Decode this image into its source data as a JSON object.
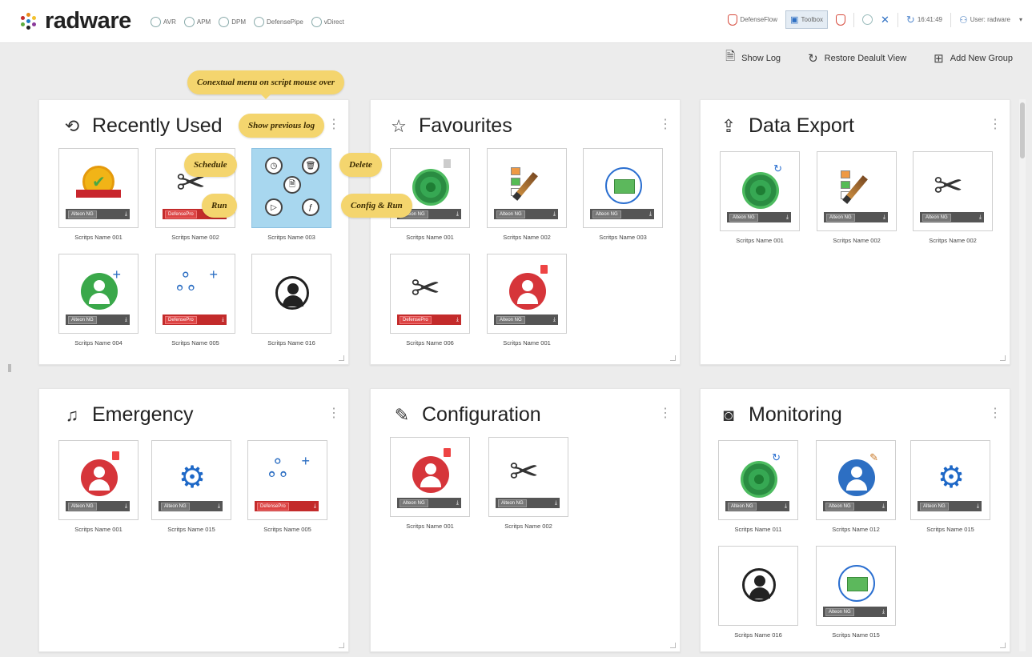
{
  "app": {
    "logo_text": "radware"
  },
  "app_nav": [
    {
      "label": "AVR"
    },
    {
      "label": "APM"
    },
    {
      "label": "DPM"
    },
    {
      "label": "DefensePipe"
    },
    {
      "label": "vDirect"
    }
  ],
  "top_right": {
    "defenseflow": "DefenseFlow",
    "toolbox": "Toolbox",
    "time": "16:41:49",
    "user": "User: radware"
  },
  "actions": {
    "show_log": "Show Log",
    "restore_default": "Restore Dealult View",
    "add_group": "Add New Group"
  },
  "callouts": {
    "contextual": "Conextual menu on script mouse over",
    "show_previous_log": "Show previous log",
    "schedule": "Schedule",
    "delete": "Delete",
    "run": "Run",
    "config_run": "Config & Run"
  },
  "panels": {
    "recent": {
      "title": "Recently Used",
      "scripts": [
        {
          "name": "Scritps Name 001",
          "tag": "Alteon NG"
        },
        {
          "name": "Scritps Name 002",
          "tag": "DefensePro"
        },
        {
          "name": "Scritps Name 003",
          "tag": ""
        },
        {
          "name": "Scritps Name 004",
          "tag": "Alteon NG"
        },
        {
          "name": "Scritps Name 005",
          "tag": "DefensePro"
        },
        {
          "name": "Scritps Name 016",
          "tag": ""
        }
      ]
    },
    "favourites": {
      "title": "Favourites",
      "scripts": [
        {
          "name": "Scritps Name 001",
          "tag": "Alteon NG"
        },
        {
          "name": "Scritps Name 002",
          "tag": "Alteon NG"
        },
        {
          "name": "Scritps Name 003",
          "tag": "Alteon NG"
        },
        {
          "name": "Scritps Name 006",
          "tag": "DefensePro"
        },
        {
          "name": "Scritps Name 001",
          "tag": "Alteon NG"
        }
      ]
    },
    "export": {
      "title": "Data Export",
      "scripts": [
        {
          "name": "Scritps Name 001",
          "tag": "Alteon NG"
        },
        {
          "name": "Scritps Name 002",
          "tag": "Alteon NG"
        },
        {
          "name": "Scritps Name 002",
          "tag": "Alteon NG"
        }
      ]
    },
    "emergency": {
      "title": "Emergency",
      "scripts": [
        {
          "name": "Scritps Name 001",
          "tag": "Alteon NG"
        },
        {
          "name": "Scritps Name 015",
          "tag": "Alteon NG"
        },
        {
          "name": "Scritps Name 005",
          "tag": "DefensePro"
        }
      ]
    },
    "configuration": {
      "title": "Configuration",
      "scripts": [
        {
          "name": "Scritps Name 001",
          "tag": "Alteon NG"
        },
        {
          "name": "Scritps Name 002",
          "tag": "Alteon NG"
        }
      ]
    },
    "monitoring": {
      "title": "Monitoring",
      "scripts": [
        {
          "name": "Scritps Name 011",
          "tag": "Alteon NG"
        },
        {
          "name": "Scritps Name 012",
          "tag": "Alteon NG"
        },
        {
          "name": "Scritps Name 015",
          "tag": "Alteon NG"
        },
        {
          "name": "Scritps Name 016",
          "tag": ""
        },
        {
          "name": "Scritps Name 015",
          "tag": "Alteon NG"
        }
      ]
    }
  },
  "colors": {
    "accent_blue": "#2d6fc3",
    "callout_yellow": "#f4d56e",
    "selected_tile": "#a8d7ef",
    "danger_red": "#d6353a"
  }
}
